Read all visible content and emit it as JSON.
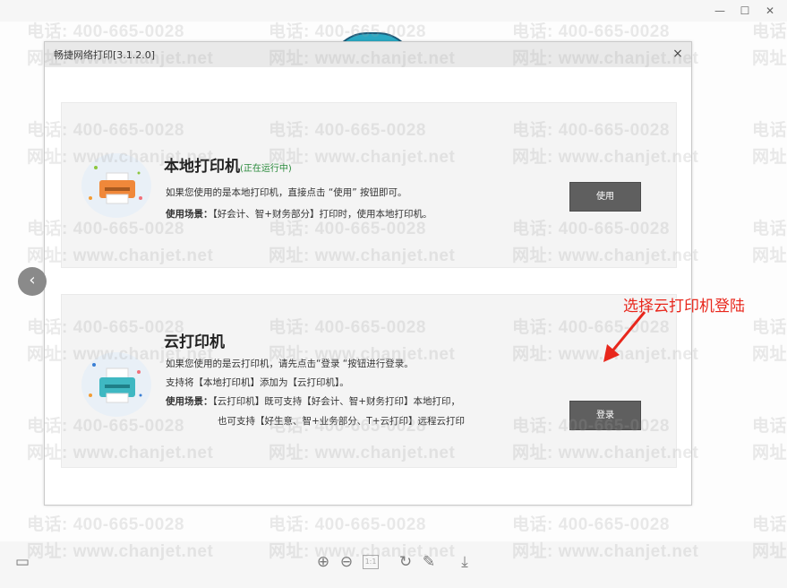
{
  "window": {
    "minimize_icon": "minimize-icon",
    "maximize_icon": "maximize-icon",
    "close_icon": "close-icon"
  },
  "watermark": {
    "phone": "电话: 400-665-0028",
    "site": "网址: www.chanjet.net"
  },
  "dialog": {
    "title": "畅捷网络打印[3.1.2.0]",
    "close_label": "×"
  },
  "local": {
    "heading": "本地打印机",
    "status": "(正在运行中)",
    "line1": "如果您使用的是本地打印机，直接点击 “使用” 按钮即可。",
    "scene_label": "使用场景：",
    "scene_text": "【好会计、智+财务部分】打印时，使用本地打印机。",
    "button": "使用"
  },
  "cloud": {
    "heading": "云打印机",
    "line1": "如果您使用的是云打印机，请先点击“登录 “按钮进行登录。",
    "line2": "支持将【本地打印机】添加为【云打印机】。",
    "scene_label": "使用场景：",
    "scene_text": "【云打印机】既可支持【好会计、智+财务打印】本地打印，",
    "scene_text2": "也可支持【好生意、智+业务部分、T+云打印】远程云打印",
    "button": "登录"
  },
  "annotation": {
    "text": "选择云打印机登陆",
    "color": "#e8271c"
  },
  "toolbar": {
    "page_box": "1:1"
  },
  "colors": {
    "button_bg": "#5f5f5f",
    "running_green": "#2a8a3c"
  }
}
